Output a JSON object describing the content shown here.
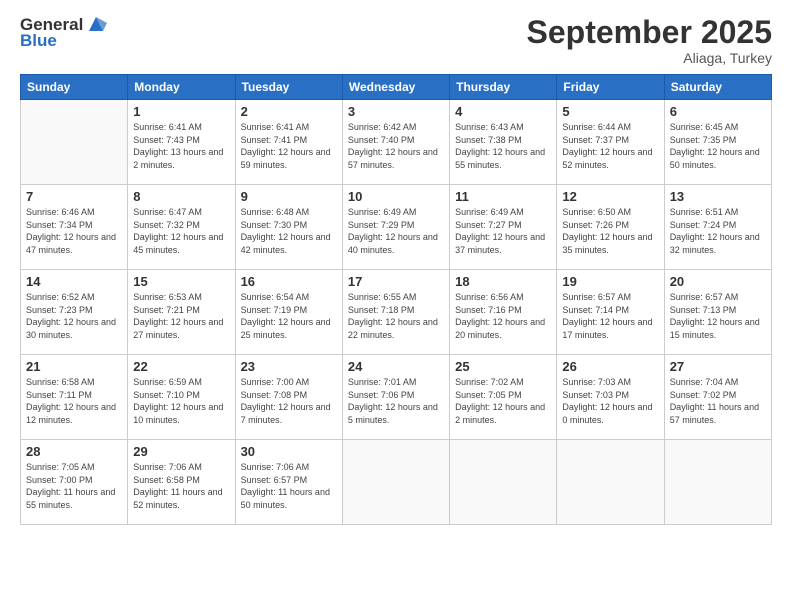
{
  "header": {
    "logo_general": "General",
    "logo_blue": "Blue",
    "month_title": "September 2025",
    "subtitle": "Aliaga, Turkey"
  },
  "weekdays": [
    "Sunday",
    "Monday",
    "Tuesday",
    "Wednesday",
    "Thursday",
    "Friday",
    "Saturday"
  ],
  "weeks": [
    [
      {
        "day": "",
        "sunrise": "",
        "sunset": "",
        "daylight": ""
      },
      {
        "day": "1",
        "sunrise": "Sunrise: 6:41 AM",
        "sunset": "Sunset: 7:43 PM",
        "daylight": "Daylight: 13 hours and 2 minutes."
      },
      {
        "day": "2",
        "sunrise": "Sunrise: 6:41 AM",
        "sunset": "Sunset: 7:41 PM",
        "daylight": "Daylight: 12 hours and 59 minutes."
      },
      {
        "day": "3",
        "sunrise": "Sunrise: 6:42 AM",
        "sunset": "Sunset: 7:40 PM",
        "daylight": "Daylight: 12 hours and 57 minutes."
      },
      {
        "day": "4",
        "sunrise": "Sunrise: 6:43 AM",
        "sunset": "Sunset: 7:38 PM",
        "daylight": "Daylight: 12 hours and 55 minutes."
      },
      {
        "day": "5",
        "sunrise": "Sunrise: 6:44 AM",
        "sunset": "Sunset: 7:37 PM",
        "daylight": "Daylight: 12 hours and 52 minutes."
      },
      {
        "day": "6",
        "sunrise": "Sunrise: 6:45 AM",
        "sunset": "Sunset: 7:35 PM",
        "daylight": "Daylight: 12 hours and 50 minutes."
      }
    ],
    [
      {
        "day": "7",
        "sunrise": "Sunrise: 6:46 AM",
        "sunset": "Sunset: 7:34 PM",
        "daylight": "Daylight: 12 hours and 47 minutes."
      },
      {
        "day": "8",
        "sunrise": "Sunrise: 6:47 AM",
        "sunset": "Sunset: 7:32 PM",
        "daylight": "Daylight: 12 hours and 45 minutes."
      },
      {
        "day": "9",
        "sunrise": "Sunrise: 6:48 AM",
        "sunset": "Sunset: 7:30 PM",
        "daylight": "Daylight: 12 hours and 42 minutes."
      },
      {
        "day": "10",
        "sunrise": "Sunrise: 6:49 AM",
        "sunset": "Sunset: 7:29 PM",
        "daylight": "Daylight: 12 hours and 40 minutes."
      },
      {
        "day": "11",
        "sunrise": "Sunrise: 6:49 AM",
        "sunset": "Sunset: 7:27 PM",
        "daylight": "Daylight: 12 hours and 37 minutes."
      },
      {
        "day": "12",
        "sunrise": "Sunrise: 6:50 AM",
        "sunset": "Sunset: 7:26 PM",
        "daylight": "Daylight: 12 hours and 35 minutes."
      },
      {
        "day": "13",
        "sunrise": "Sunrise: 6:51 AM",
        "sunset": "Sunset: 7:24 PM",
        "daylight": "Daylight: 12 hours and 32 minutes."
      }
    ],
    [
      {
        "day": "14",
        "sunrise": "Sunrise: 6:52 AM",
        "sunset": "Sunset: 7:23 PM",
        "daylight": "Daylight: 12 hours and 30 minutes."
      },
      {
        "day": "15",
        "sunrise": "Sunrise: 6:53 AM",
        "sunset": "Sunset: 7:21 PM",
        "daylight": "Daylight: 12 hours and 27 minutes."
      },
      {
        "day": "16",
        "sunrise": "Sunrise: 6:54 AM",
        "sunset": "Sunset: 7:19 PM",
        "daylight": "Daylight: 12 hours and 25 minutes."
      },
      {
        "day": "17",
        "sunrise": "Sunrise: 6:55 AM",
        "sunset": "Sunset: 7:18 PM",
        "daylight": "Daylight: 12 hours and 22 minutes."
      },
      {
        "day": "18",
        "sunrise": "Sunrise: 6:56 AM",
        "sunset": "Sunset: 7:16 PM",
        "daylight": "Daylight: 12 hours and 20 minutes."
      },
      {
        "day": "19",
        "sunrise": "Sunrise: 6:57 AM",
        "sunset": "Sunset: 7:14 PM",
        "daylight": "Daylight: 12 hours and 17 minutes."
      },
      {
        "day": "20",
        "sunrise": "Sunrise: 6:57 AM",
        "sunset": "Sunset: 7:13 PM",
        "daylight": "Daylight: 12 hours and 15 minutes."
      }
    ],
    [
      {
        "day": "21",
        "sunrise": "Sunrise: 6:58 AM",
        "sunset": "Sunset: 7:11 PM",
        "daylight": "Daylight: 12 hours and 12 minutes."
      },
      {
        "day": "22",
        "sunrise": "Sunrise: 6:59 AM",
        "sunset": "Sunset: 7:10 PM",
        "daylight": "Daylight: 12 hours and 10 minutes."
      },
      {
        "day": "23",
        "sunrise": "Sunrise: 7:00 AM",
        "sunset": "Sunset: 7:08 PM",
        "daylight": "Daylight: 12 hours and 7 minutes."
      },
      {
        "day": "24",
        "sunrise": "Sunrise: 7:01 AM",
        "sunset": "Sunset: 7:06 PM",
        "daylight": "Daylight: 12 hours and 5 minutes."
      },
      {
        "day": "25",
        "sunrise": "Sunrise: 7:02 AM",
        "sunset": "Sunset: 7:05 PM",
        "daylight": "Daylight: 12 hours and 2 minutes."
      },
      {
        "day": "26",
        "sunrise": "Sunrise: 7:03 AM",
        "sunset": "Sunset: 7:03 PM",
        "daylight": "Daylight: 12 hours and 0 minutes."
      },
      {
        "day": "27",
        "sunrise": "Sunrise: 7:04 AM",
        "sunset": "Sunset: 7:02 PM",
        "daylight": "Daylight: 11 hours and 57 minutes."
      }
    ],
    [
      {
        "day": "28",
        "sunrise": "Sunrise: 7:05 AM",
        "sunset": "Sunset: 7:00 PM",
        "daylight": "Daylight: 11 hours and 55 minutes."
      },
      {
        "day": "29",
        "sunrise": "Sunrise: 7:06 AM",
        "sunset": "Sunset: 6:58 PM",
        "daylight": "Daylight: 11 hours and 52 minutes."
      },
      {
        "day": "30",
        "sunrise": "Sunrise: 7:06 AM",
        "sunset": "Sunset: 6:57 PM",
        "daylight": "Daylight: 11 hours and 50 minutes."
      },
      {
        "day": "",
        "sunrise": "",
        "sunset": "",
        "daylight": ""
      },
      {
        "day": "",
        "sunrise": "",
        "sunset": "",
        "daylight": ""
      },
      {
        "day": "",
        "sunrise": "",
        "sunset": "",
        "daylight": ""
      },
      {
        "day": "",
        "sunrise": "",
        "sunset": "",
        "daylight": ""
      }
    ]
  ]
}
